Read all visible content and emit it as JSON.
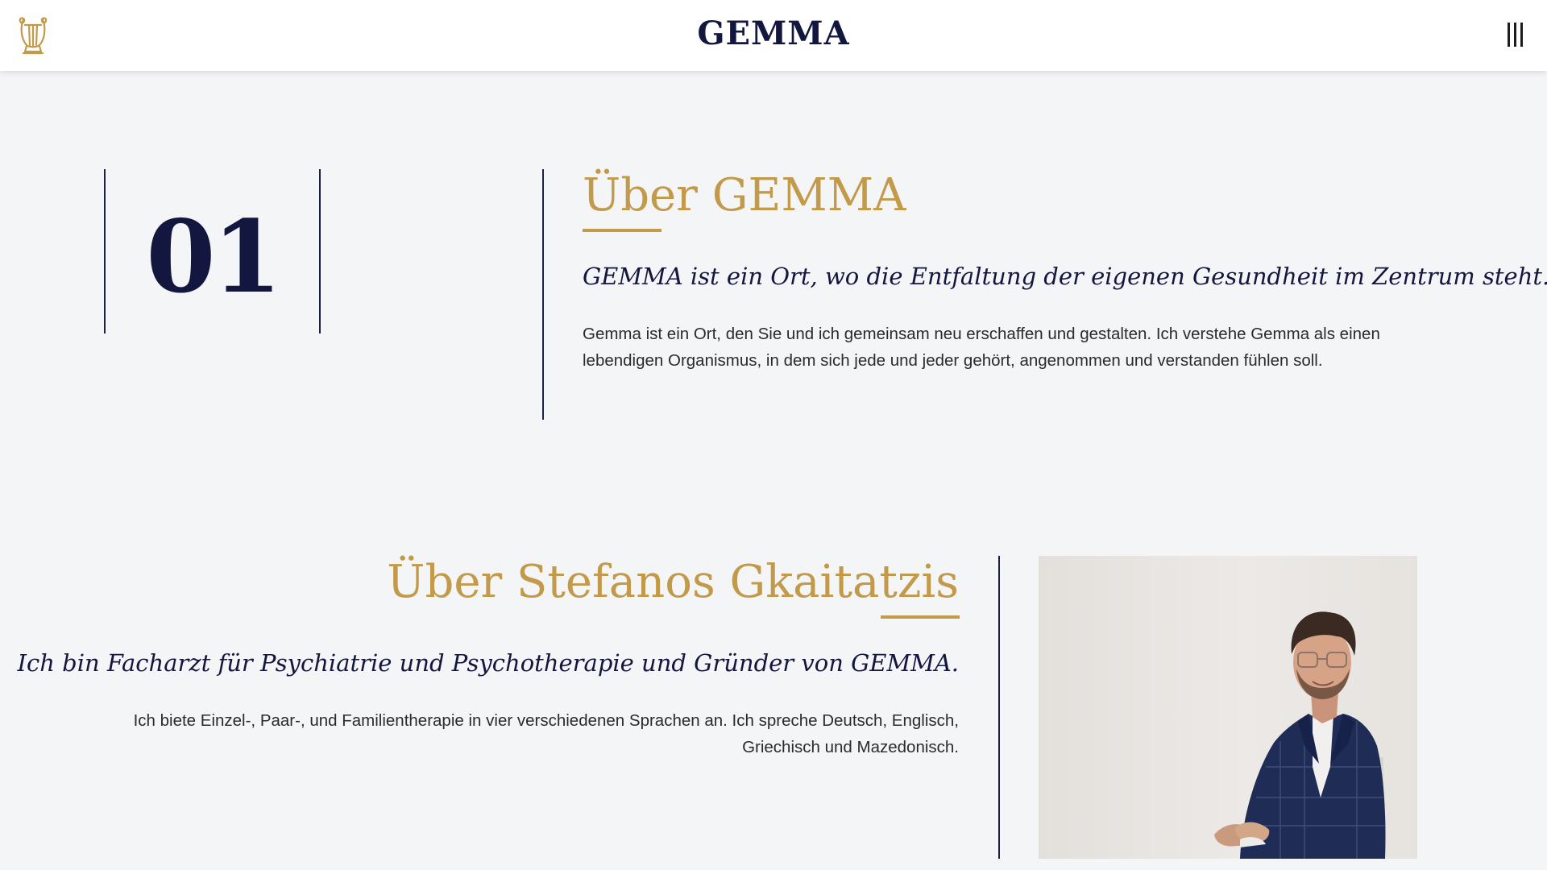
{
  "header": {
    "brand": "GEMMA",
    "logo_icon": "lyre-icon",
    "menu_icon": "menu-icon"
  },
  "about_gemma": {
    "number": "01",
    "title": "Über GEMMA",
    "lead": "GEMMA ist ein Ort, wo die Entfaltung der eigenen Gesundheit im Zentrum steht.",
    "body": "Gemma ist ein Ort, den Sie und ich gemeinsam neu erschaffen und gestalten. Ich verstehe Gemma als einen lebendigen Organismus, in dem sich jede und jeder gehört, angenommen und verstanden fühlen soll."
  },
  "about_founder": {
    "title": "Über Stefanos Gkaitatzis",
    "lead": "Ich bin Facharzt für Psychiatrie und Psychotherapie und Gründer von GEMMA.",
    "body": "Ich biete Einzel-, Paar-, und Familientherapie in vier verschiedenen Sprachen an. Ich spreche Deutsch, Englisch, Griechisch und Mazedonisch."
  },
  "colors": {
    "gold": "#c39a4a",
    "navy": "#13163f",
    "background": "#f4f5f7"
  }
}
